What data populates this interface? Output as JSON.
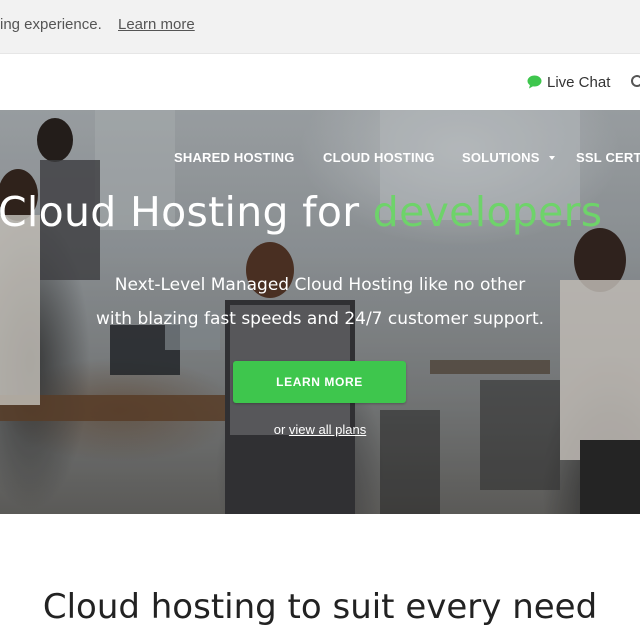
{
  "cookie_bar": {
    "text": "ing experience.",
    "link": "Learn more"
  },
  "top_bar": {
    "live_chat": "Live Chat",
    "icons": [
      "chat-bubble-icon",
      "globe-icon"
    ],
    "accent_color": "#3ec64d"
  },
  "nav": {
    "items": [
      "SHARED HOSTING",
      "CLOUD HOSTING",
      "SOLUTIONS",
      "SSL CERT"
    ]
  },
  "hero": {
    "heading_main": "Cloud Hosting for",
    "heading_accent": "developers",
    "subtitle_line1": "Next-Level Managed Cloud Hosting like no other",
    "subtitle_line2": "with blazing fast speeds and 24/7 customer support.",
    "cta_label": "LEARN MORE",
    "alt_prefix": "or",
    "alt_link": "view all plans",
    "accent_color": "#6ed36a",
    "button_color": "#3ec64d"
  },
  "section": {
    "title": "Cloud hosting to suit every need"
  }
}
